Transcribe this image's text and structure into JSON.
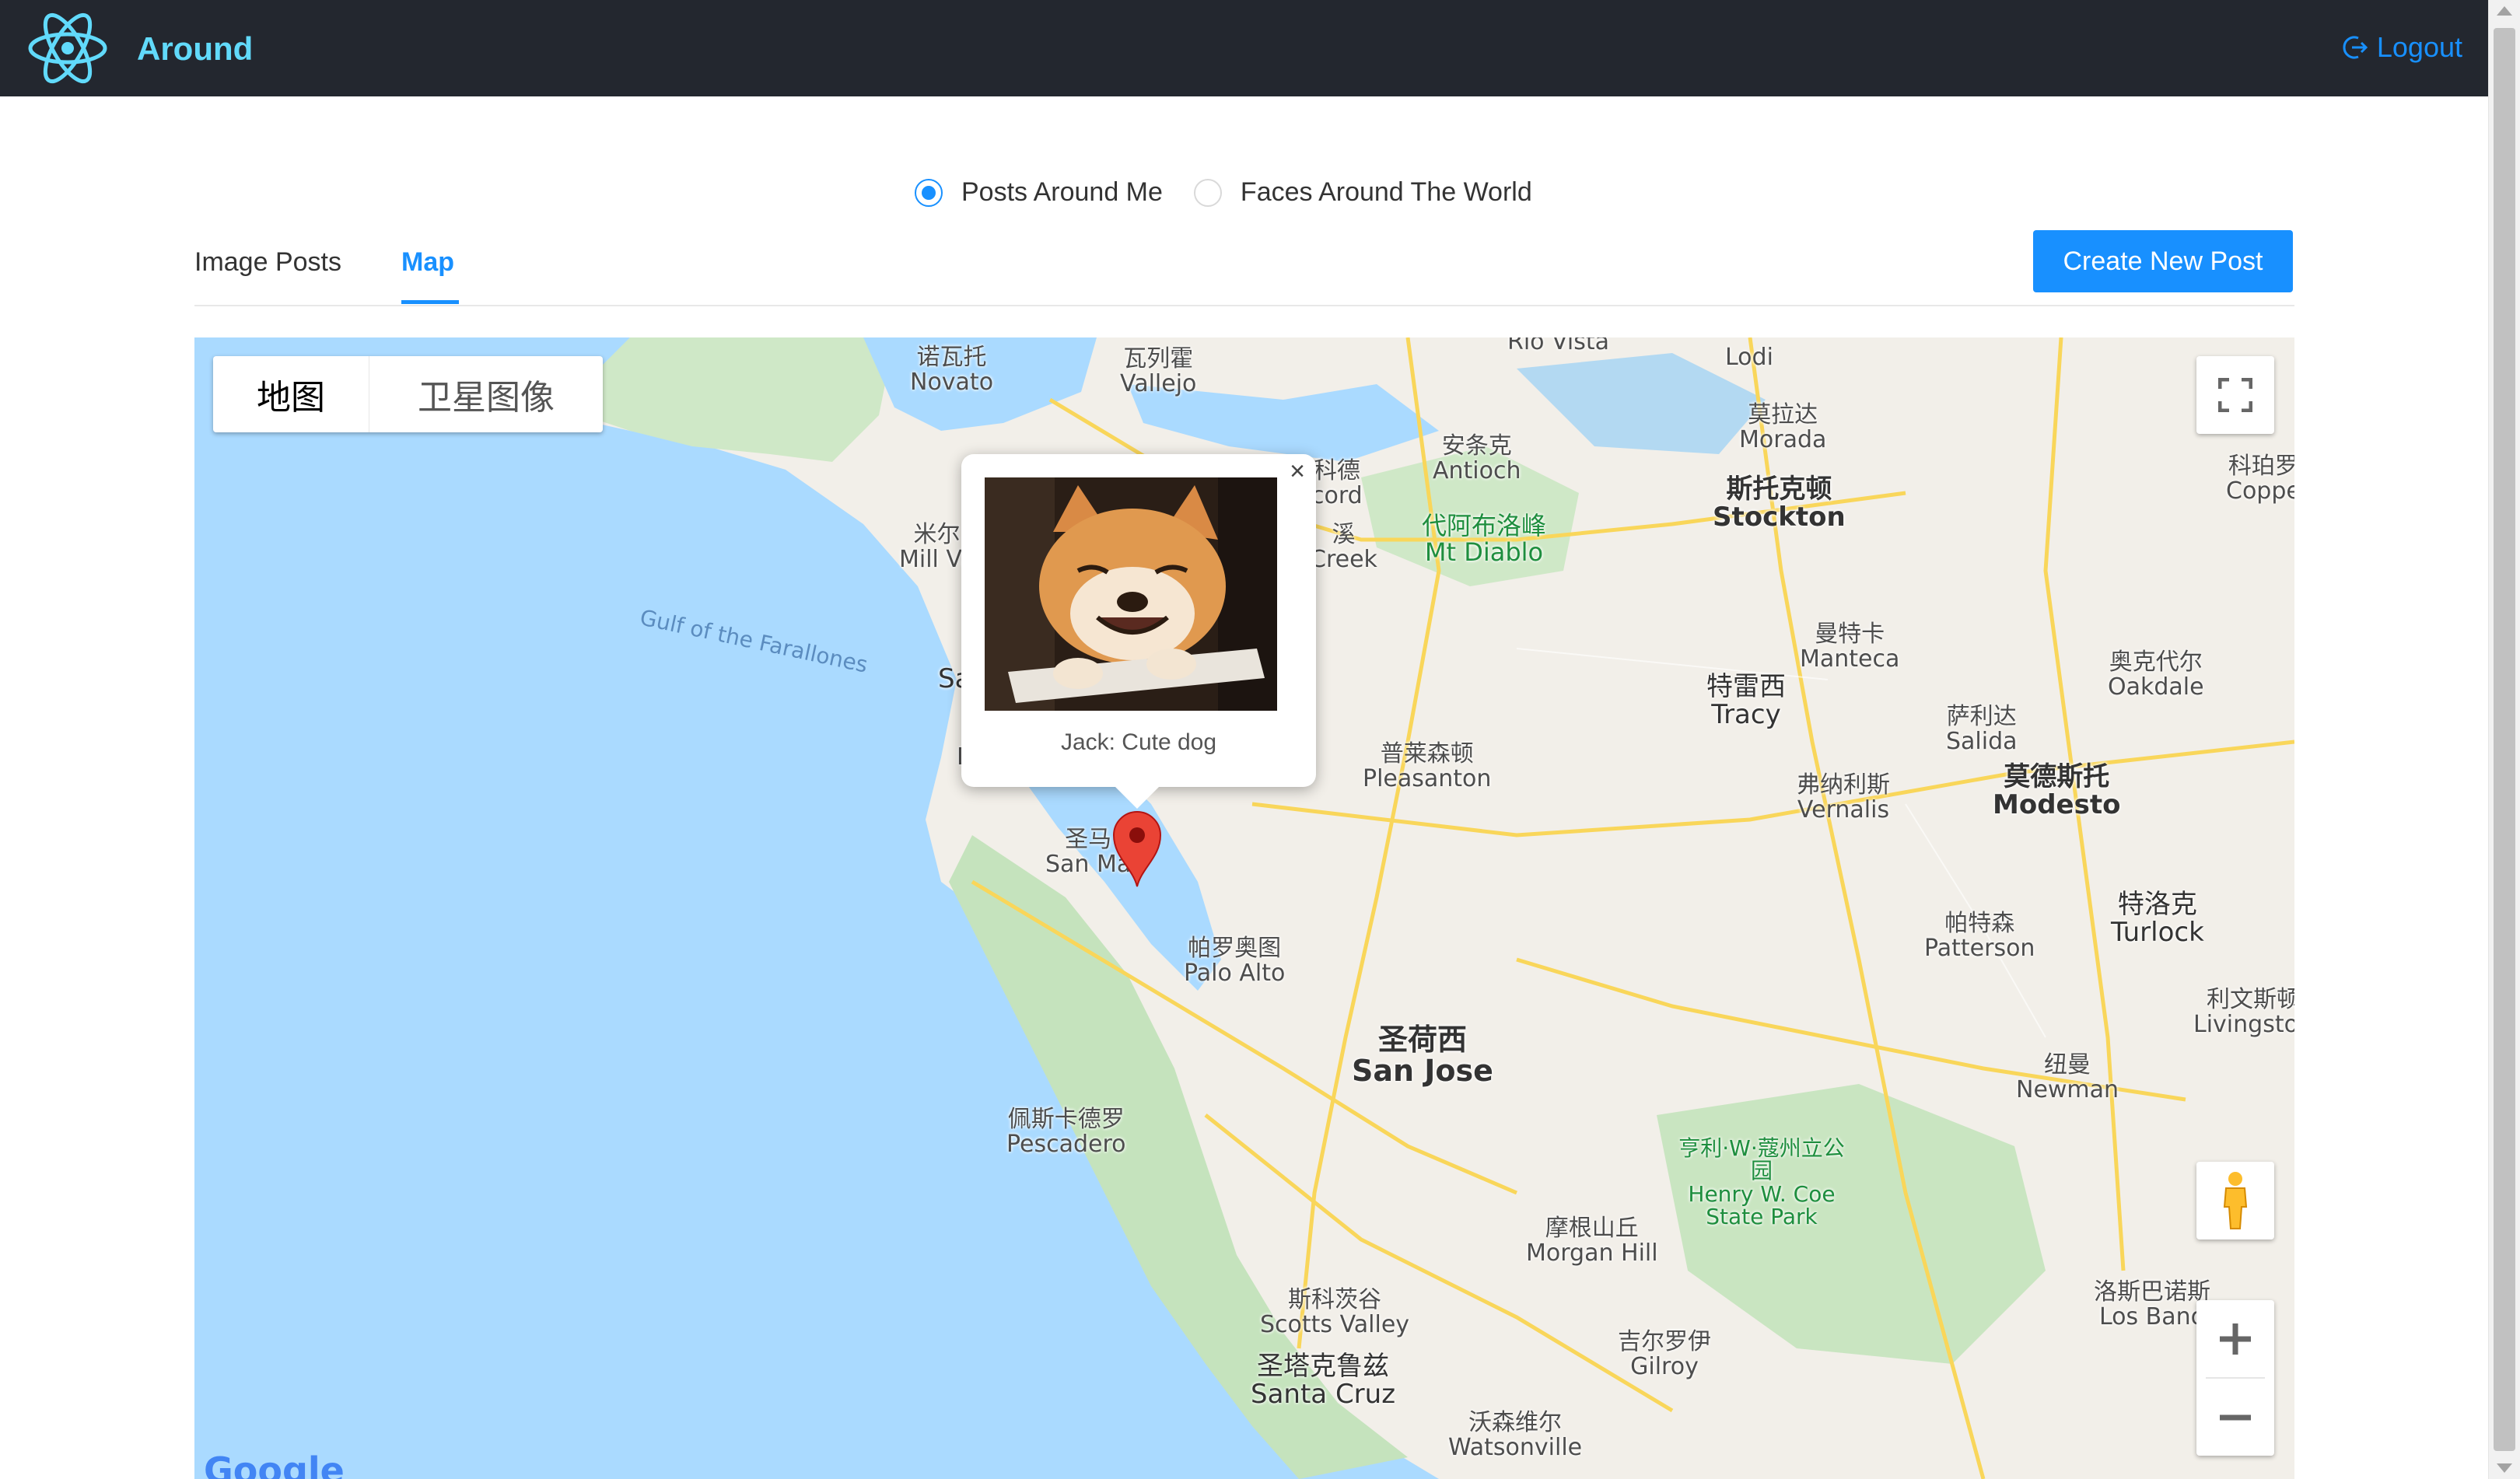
{
  "header": {
    "app_title": "Around",
    "logout_label": "Logout",
    "brand_color": "#61dafb",
    "bg_color": "#23272f"
  },
  "topic_selector": {
    "options": [
      {
        "label": "Posts Around Me",
        "checked": true
      },
      {
        "label": "Faces Around The World",
        "checked": false
      }
    ]
  },
  "tabs": {
    "items": [
      {
        "label": "Image Posts",
        "active": false
      },
      {
        "label": "Map",
        "active": true
      }
    ],
    "create_button_label": "Create New Post",
    "accent_color": "#1890ff"
  },
  "map": {
    "type_control": {
      "map_label": "地图",
      "satellite_label": "卫星图像",
      "selected": "地图"
    },
    "popup": {
      "caption": "Jack: Cute dog",
      "close_label": "×"
    },
    "watermark": "Google",
    "place_labels": [
      {
        "zh": "诺瓦托",
        "en": "Novato"
      },
      {
        "zh": "瓦列霍",
        "en": "Vallejo"
      },
      {
        "zh": "",
        "en": "Rio Vista"
      },
      {
        "zh": "",
        "en": "Lodi"
      },
      {
        "zh": "莫拉达",
        "en": "Morada"
      },
      {
        "zh": "安条克",
        "en": "Antioch"
      },
      {
        "zh": "科德",
        "en": "cord"
      },
      {
        "zh": "斯托克顿",
        "en": "Stockton"
      },
      {
        "zh": "科珀罗",
        "en": "Coppe"
      },
      {
        "zh": "米尔",
        "en": "Mill Va"
      },
      {
        "zh": "代阿布洛峰",
        "en": "Mt Diablo"
      },
      {
        "zh": "溪",
        "en": "Creek"
      },
      {
        "zh": "曼特卡",
        "en": "Manteca"
      },
      {
        "zh": "奥克代尔",
        "en": "Oakdale"
      },
      {
        "zh": "特雷西",
        "en": "Tracy"
      },
      {
        "zh": "萨利达",
        "en": "Salida"
      },
      {
        "zh": "普莱森顿",
        "en": "Pleasanton"
      },
      {
        "zh": "弗纳利斯",
        "en": "Vernalis"
      },
      {
        "zh": "莫德斯托",
        "en": "Modesto"
      },
      {
        "zh": "圣马",
        "en": "San Ma"
      },
      {
        "zh": "帕罗奥图",
        "en": "Palo Alto"
      },
      {
        "zh": "帕特森",
        "en": "Patterson"
      },
      {
        "zh": "特洛克",
        "en": "Turlock"
      },
      {
        "zh": "利文斯顿",
        "en": "Livingston"
      },
      {
        "zh": "圣荷西",
        "en": "San Jose"
      },
      {
        "zh": "纽曼",
        "en": "Newman"
      },
      {
        "zh": "佩斯卡德罗",
        "en": "Pescadero"
      },
      {
        "zh": "亨利·W·蔻州立公园",
        "en": "Henry W. Coe State Park"
      },
      {
        "zh": "摩根山丘",
        "en": "Morgan Hill"
      },
      {
        "zh": "斯科茨谷",
        "en": "Scotts Valley"
      },
      {
        "zh": "洛斯巴诺斯",
        "en": "Los Bano"
      },
      {
        "zh": "吉尔罗伊",
        "en": "Gilroy"
      },
      {
        "zh": "圣塔克鲁兹",
        "en": "Santa Cruz"
      },
      {
        "zh": "沃森维尔",
        "en": "Watsonville"
      }
    ],
    "sea_label": "Gulf of the Farallones",
    "partial_label_left": "Sa",
    "partial_label_d": "D"
  }
}
